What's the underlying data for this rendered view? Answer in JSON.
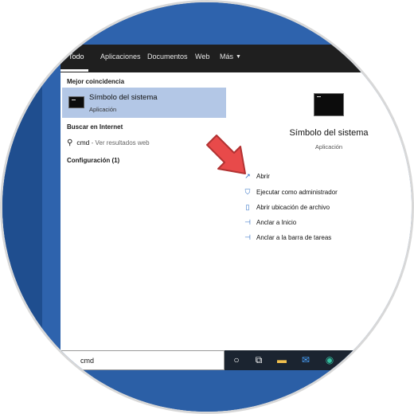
{
  "tabs": [
    {
      "label": "Todo",
      "active": true
    },
    {
      "label": "Aplicaciones"
    },
    {
      "label": "Documentos"
    },
    {
      "label": "Web"
    },
    {
      "label": "Más"
    }
  ],
  "left": {
    "best_match_heading": "Mejor coincidencia",
    "best_match": {
      "title": "Símbolo del sistema",
      "subtitle": "Aplicación"
    },
    "internet_heading": "Buscar en Internet",
    "web_result": {
      "query": "cmd",
      "suffix": " - Ver resultados web"
    },
    "settings_heading": "Configuración (1)"
  },
  "right": {
    "title": "Símbolo del sistema",
    "subtitle": "Aplicación",
    "actions": [
      {
        "label": "Abrir",
        "icon": "open-icon"
      },
      {
        "label": "Ejecutar como administrador",
        "icon": "shield-icon"
      },
      {
        "label": "Abrir ubicación de archivo",
        "icon": "file-location-icon"
      },
      {
        "label": "Anclar a Inicio",
        "icon": "pin-icon"
      },
      {
        "label": "Anclar a la barra de tareas",
        "icon": "pin-icon"
      }
    ]
  },
  "search": {
    "value": "cmd"
  },
  "taskbar": {
    "icons": [
      "cortana-icon",
      "task-view-icon",
      "file-explorer-icon",
      "mail-icon",
      "edge-icon"
    ]
  },
  "colors": {
    "highlight": "#b3c7e6",
    "topbar": "#1f1f1f",
    "accent": "#2a6bc2",
    "arrow": "#e84a4a",
    "desktop": "#2e63ad"
  }
}
